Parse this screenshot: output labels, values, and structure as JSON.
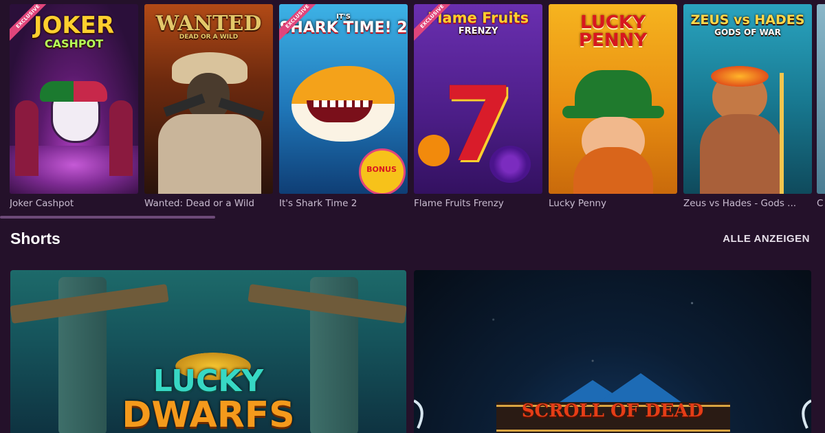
{
  "games": [
    {
      "title": "Joker Cashpot",
      "logo_line1": "JOKER",
      "logo_line2": "CASHPOT",
      "badge": "EXCLUSIVE"
    },
    {
      "title": "Wanted: Dead or a Wild",
      "logo_line1": "WANTED",
      "logo_line2": "DEAD OR A WILD",
      "badge": ""
    },
    {
      "title": "It's Shark Time 2",
      "logo_line1": "IT'S",
      "logo_line2": "SHARK TIME! 2",
      "badge": "EXCLUSIVE",
      "bonus": "BONUS"
    },
    {
      "title": "Flame Fruits Frenzy",
      "logo_line1": "Flame Fruits",
      "logo_line2": "FRENZY",
      "badge": "EXCLUSIVE"
    },
    {
      "title": "Lucky Penny",
      "logo_line1": "LUCKY",
      "logo_line2": "PENNY",
      "badge": ""
    },
    {
      "title": "Zeus vs Hades - Gods ...",
      "logo_line1": "ZEUS vs HADES",
      "logo_line2": "GODS OF WAR",
      "badge": ""
    },
    {
      "title": "C",
      "logo_line1": "",
      "logo_line2": "",
      "badge": ""
    }
  ],
  "section": {
    "title": "Shorts",
    "show_all": "ALLE ANZEIGEN"
  },
  "shorts": [
    {
      "logo_line1": "LUCKY",
      "logo_line2": "DWARFS"
    },
    {
      "logo_line1": "SCROLL OF DEAD"
    }
  ],
  "colors": {
    "background": "#24112a",
    "badge": "#e0457b",
    "scroll_indicator": "#6d4a78"
  }
}
